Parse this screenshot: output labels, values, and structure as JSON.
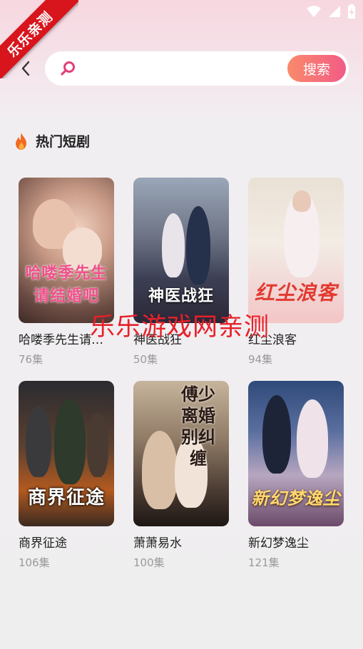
{
  "status_bar": {
    "icons": [
      "wifi-icon",
      "signal-icon",
      "battery-icon"
    ]
  },
  "ribbon": {
    "text": "乐乐亲测"
  },
  "header": {
    "back_icon": "chevron-left-icon",
    "search": {
      "placeholder": "",
      "value": "",
      "icon": "search-icon",
      "button_label": "搜索"
    }
  },
  "section": {
    "icon": "fire-icon",
    "title": "热门短剧"
  },
  "dramas": [
    {
      "title": "哈喽季先生请结婚吧",
      "count": "76集",
      "poster_text": "哈喽季先生请结婚吧"
    },
    {
      "title": "神医战狂",
      "count": "50集",
      "poster_text": "神医战狂"
    },
    {
      "title": "红尘浪客",
      "count": "94集",
      "poster_text": "红尘浪客"
    },
    {
      "title": "商界征途",
      "count": "106集",
      "poster_text": "商界征途"
    },
    {
      "title": "萧萧易水",
      "count": "100集",
      "poster_text": "傅少离婚别纠缠"
    },
    {
      "title": "新幻梦逸尘",
      "count": "121集",
      "poster_text": "新幻梦逸尘"
    }
  ],
  "watermark": {
    "text": "乐乐游戏网亲测"
  },
  "colors": {
    "accent_start": "#fa8a6b",
    "accent_end": "#f25b86",
    "ribbon": "#d8141c",
    "watermark": "#e8202a"
  }
}
